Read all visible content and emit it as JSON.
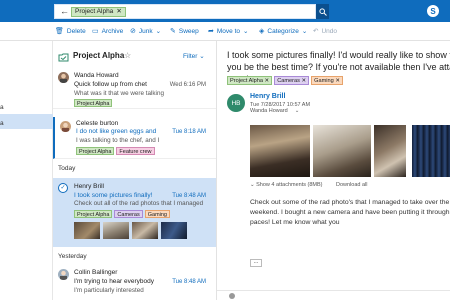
{
  "search": {
    "chip": "Project Alpha",
    "clear": "✕"
  },
  "toolbar": {
    "delete": "Delete",
    "archive": "Archive",
    "junk": "Junk",
    "sweep": "Sweep",
    "move_to": "Move to",
    "categorize": "Categorize",
    "undo": "Undo"
  },
  "list": {
    "folder_title": "Project Alpha",
    "filter_label": "Filter",
    "section_today": "Today",
    "section_yesterday": "Yesterday",
    "messages": [
      {
        "sender": "Wanda Howard",
        "subject": "Quick follow up from chet",
        "preview": "What was it that we were talking",
        "time": "Wed 6:16 PM",
        "tags": [
          "Project Alpha"
        ]
      },
      {
        "sender": "Celeste burton",
        "subject": "I do not like green eggs and",
        "preview": "I was talking to the chef, and I",
        "time": "Tue 8:18 AM",
        "tags": [
          "Project Alpha",
          "Feature crew"
        ]
      },
      {
        "sender": "Henry Brill",
        "subject": "I took some pictures finally!",
        "preview": "Check out all of the rad photos that I managed",
        "time": "Tue 8:48 AM",
        "tags": [
          "Project Alpha",
          "Cameras",
          "Gaming"
        ]
      },
      {
        "sender": "Collin Ballinger",
        "subject": "I'm trying to hear everybody",
        "preview": "I'm particularly interested",
        "time": "Tue 8:48 AM",
        "tags": []
      }
    ]
  },
  "reading": {
    "subject": "I took some pictures finally! I'd would really like to show them to you be the best time? If you're not available then I've attached a couple",
    "tags": [
      "Project Alpha",
      "Cameras",
      "Gaming"
    ],
    "avatar_initials": "HB",
    "sender": "Henry Brill",
    "date": "Tue 7/28/2017 10:57 AM",
    "to": "Wanda Howard",
    "attachments_text": "Show 4 attachments (8MB)",
    "download_all": "Download all",
    "body": "Check out some of the rad photo's that I managed to take over the weekend. I bought a new camera and have been putting it through it's paces! Let me know what you",
    "more": "..."
  },
  "leftnav": {
    "item_a": "a",
    "item_b": "a"
  },
  "colors": {
    "accent": "#0f6cbd",
    "selected_row": "#cfe1f6",
    "header_bg": "#0f6cbd"
  }
}
